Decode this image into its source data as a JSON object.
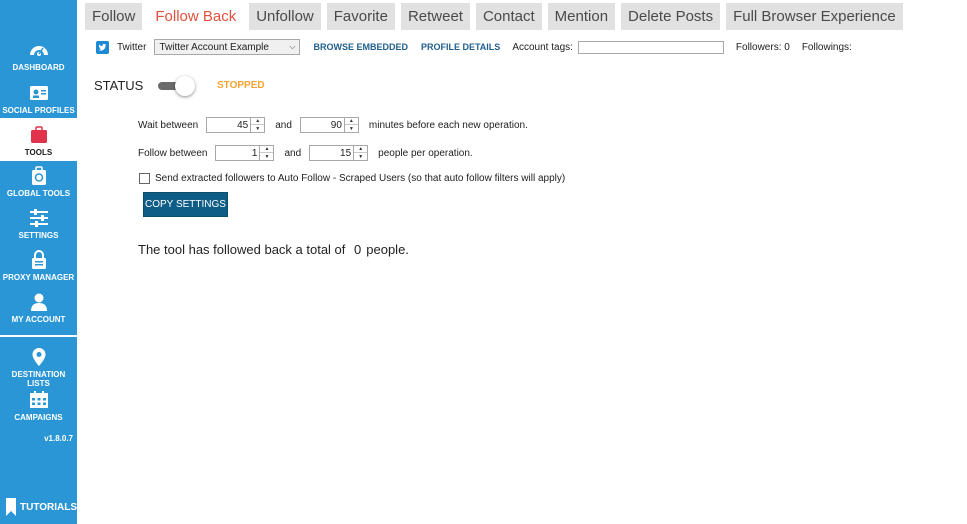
{
  "sidebar": {
    "items": [
      {
        "label": "DASHBOARD",
        "icon": "gauge-icon"
      },
      {
        "label": "SOCIAL PROFILES",
        "icon": "id-card-icon"
      },
      {
        "label": "TOOLS",
        "icon": "toolbox-icon"
      },
      {
        "label": "GLOBAL TOOLS",
        "icon": "global-tools-icon"
      },
      {
        "label": "SETTINGS",
        "icon": "sliders-icon"
      },
      {
        "label": "PROXY MANAGER",
        "icon": "lock-icon"
      },
      {
        "label": "MY ACCOUNT",
        "icon": "user-icon"
      },
      {
        "label": "DESTINATION LISTS",
        "icon": "map-pin-icon"
      },
      {
        "label": "CAMPAIGNS",
        "icon": "calendar-icon"
      }
    ],
    "version": "v1.8.0.7",
    "tutorials_label": "TUTORIALS",
    "accent_color": "#2b96d6"
  },
  "tabs": [
    {
      "label": "Follow"
    },
    {
      "label": "Follow Back"
    },
    {
      "label": "Unfollow"
    },
    {
      "label": "Favorite"
    },
    {
      "label": "Retweet"
    },
    {
      "label": "Contact"
    },
    {
      "label": "Mention"
    },
    {
      "label": "Delete Posts"
    },
    {
      "label": "Full Browser Experience"
    }
  ],
  "account_bar": {
    "network_label": "Twitter",
    "account_selected": "Twitter Account Example",
    "browse_embedded": "BROWSE EMBEDDED",
    "profile_details": "PROFILE DETAILS",
    "tags_label": "Account tags:",
    "tags_value": "",
    "followers": "Followers: 0",
    "followings": "Followings:"
  },
  "status": {
    "label": "STATUS",
    "value": "STOPPED",
    "enabled": false,
    "value_color": "#f4a335"
  },
  "settings": {
    "wait_label": "Wait between",
    "wait_min": "45",
    "wait_and": "and",
    "wait_max": "90",
    "wait_suffix": "minutes before each new operation.",
    "follow_label": "Follow between",
    "follow_min": "1",
    "follow_and": "and",
    "follow_max": "15",
    "follow_suffix": "people per operation.",
    "send_extracted_label": "Send extracted followers to Auto Follow - Scraped Users (so that auto follow filters will apply)",
    "send_extracted_checked": false,
    "copy_settings": "COPY SETTINGS"
  },
  "summary": {
    "prefix": "The tool has followed back a total of",
    "count": "0",
    "suffix": "people."
  }
}
